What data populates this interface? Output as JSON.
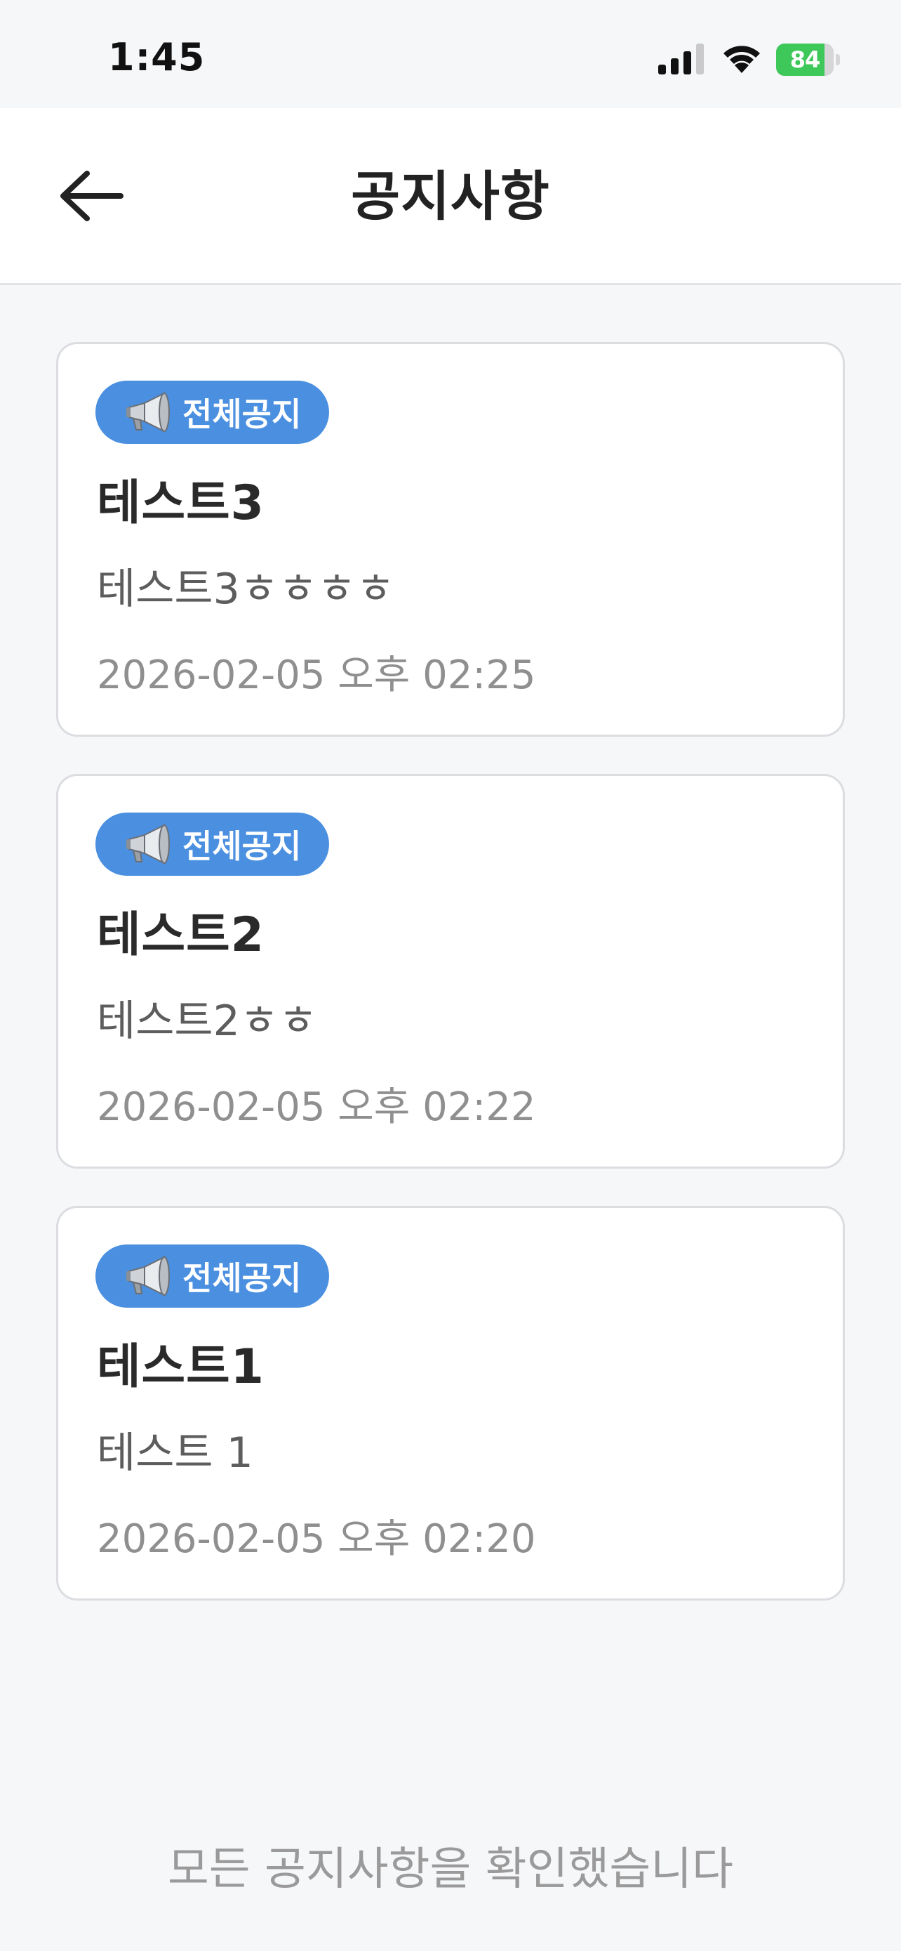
{
  "status_bar": {
    "time": "1:45",
    "battery_percent": 84,
    "battery_label": "84",
    "battery_color": "#3ec85a",
    "icons": [
      "cellular-signal-icon",
      "wifi-icon",
      "battery-charging-icon"
    ]
  },
  "header": {
    "back_icon": "arrow-left-icon",
    "title": "공지사항"
  },
  "notices": [
    {
      "badge": "전체공지",
      "badge_icon": "megaphone-icon",
      "title": "테스트3",
      "body": "테스트3ㅎㅎㅎㅎ",
      "date": "2026-02-05 오후 02:25"
    },
    {
      "badge": "전체공지",
      "badge_icon": "megaphone-icon",
      "title": "테스트2",
      "body": "테스트2ㅎㅎ",
      "date": "2026-02-05 오후 02:22"
    },
    {
      "badge": "전체공지",
      "badge_icon": "megaphone-icon",
      "title": "테스트1",
      "body": "테스트 1",
      "date": "2026-02-05 오후 02:20"
    }
  ],
  "footer": {
    "end_message": "모든 공지사항을 확인했습니다"
  },
  "colors": {
    "background": "#f6f7f9",
    "badge": "#4a8fe0",
    "card_border": "#dcdde0"
  }
}
